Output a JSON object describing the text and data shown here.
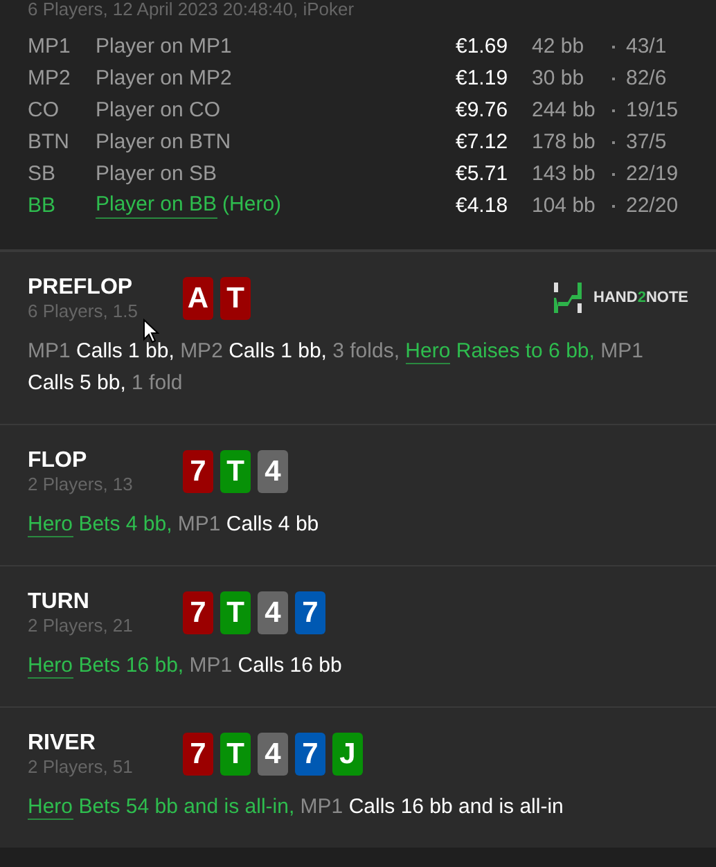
{
  "summary": "6 Players, 12 April 2023 20:48:40, iPoker",
  "players": [
    {
      "position": "MP1",
      "name": "Player on MP1",
      "stack": "€1.69",
      "bb": "42 bb",
      "stats": "43/1",
      "hero": false
    },
    {
      "position": "MP2",
      "name": "Player on MP2",
      "stack": "€1.19",
      "bb": "30 bb",
      "stats": "82/6",
      "hero": false
    },
    {
      "position": "CO",
      "name": "Player on CO",
      "stack": "€9.76",
      "bb": "244 bb",
      "stats": "19/15",
      "hero": false
    },
    {
      "position": "BTN",
      "name": "Player on BTN",
      "stack": "€7.12",
      "bb": "178 bb",
      "stats": "37/5",
      "hero": false
    },
    {
      "position": "SB",
      "name": "Player on SB",
      "stack": "€5.71",
      "bb": "143 bb",
      "stats": "22/19",
      "hero": false
    },
    {
      "position": "BB",
      "name": "Player on BB",
      "hero_tag": "(Hero)",
      "stack": "€4.18",
      "bb": "104 bb",
      "stats": "22/20",
      "hero": true
    }
  ],
  "logo": {
    "prefix": "HAND",
    "accent": "2",
    "suffix": "NOTE"
  },
  "streets": [
    {
      "title": "PREFLOP",
      "info": "6 Players, 1.5",
      "cards": [
        {
          "rank": "A",
          "color": "#9b0000"
        },
        {
          "rank": "T",
          "color": "#9b0000"
        }
      ],
      "actions": [
        {
          "kind": "player",
          "text": "MP1"
        },
        {
          "kind": "action",
          "text": "Calls 1 bb,"
        },
        {
          "kind": "player",
          "text": "MP2"
        },
        {
          "kind": "action",
          "text": "Calls 1 bb,"
        },
        {
          "kind": "fold",
          "text": "3 folds,"
        },
        {
          "kind": "hero",
          "text": "Hero"
        },
        {
          "kind": "hero_action",
          "text": "Raises to 6 bb,"
        },
        {
          "kind": "player",
          "text": "MP1"
        },
        {
          "kind": "action",
          "text": "Calls 5 bb,"
        },
        {
          "kind": "fold",
          "text": "1 fold"
        }
      ]
    },
    {
      "title": "FLOP",
      "info": "2 Players, 13",
      "cards": [
        {
          "rank": "7",
          "color": "#9b0000"
        },
        {
          "rank": "T",
          "color": "#079107"
        },
        {
          "rank": "4",
          "color": "#666666"
        }
      ],
      "actions": [
        {
          "kind": "hero",
          "text": "Hero"
        },
        {
          "kind": "hero_action",
          "text": "Bets 4 bb,"
        },
        {
          "kind": "player",
          "text": "MP1"
        },
        {
          "kind": "action",
          "text": "Calls 4 bb"
        }
      ]
    },
    {
      "title": "TURN",
      "info": "2 Players, 21",
      "cards": [
        {
          "rank": "7",
          "color": "#9b0000"
        },
        {
          "rank": "T",
          "color": "#079107"
        },
        {
          "rank": "4",
          "color": "#666666"
        },
        {
          "rank": "7",
          "color": "#0059b3"
        }
      ],
      "actions": [
        {
          "kind": "hero",
          "text": "Hero"
        },
        {
          "kind": "hero_action",
          "text": "Bets 16 bb,"
        },
        {
          "kind": "player",
          "text": "MP1"
        },
        {
          "kind": "action",
          "text": "Calls 16 bb"
        }
      ]
    },
    {
      "title": "RIVER",
      "info": "2 Players, 51",
      "cards": [
        {
          "rank": "7",
          "color": "#9b0000"
        },
        {
          "rank": "T",
          "color": "#079107"
        },
        {
          "rank": "4",
          "color": "#666666"
        },
        {
          "rank": "7",
          "color": "#0059b3"
        },
        {
          "rank": "J",
          "color": "#079107"
        }
      ],
      "actions": [
        {
          "kind": "hero",
          "text": "Hero"
        },
        {
          "kind": "hero_action",
          "text": "Bets 54 bb and is all-in,"
        },
        {
          "kind": "player",
          "text": "MP1"
        },
        {
          "kind": "action",
          "text": "Calls 16 bb and is all-in"
        }
      ]
    }
  ]
}
